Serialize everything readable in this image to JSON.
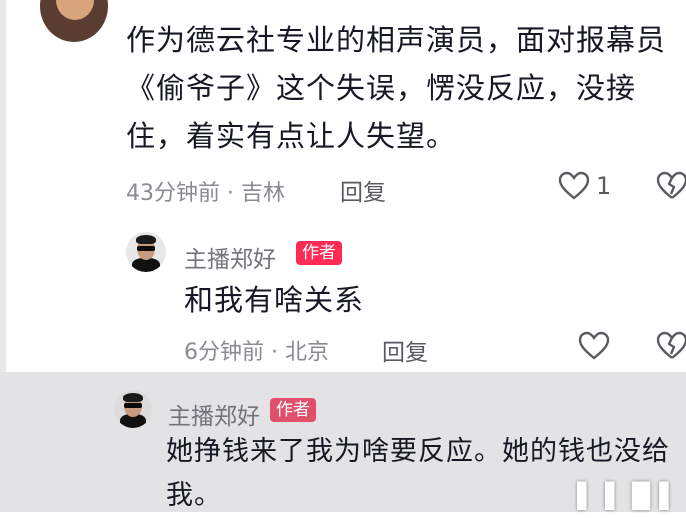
{
  "comment1": {
    "text_lines": [
      "作为德云社专业的相声演员，面对报幕员",
      "《偷爷子》这个失误，愣没反应，没接",
      "住，着实有点让人失望。"
    ],
    "meta": "43分钟前 · 吉林",
    "reply_label": "回复",
    "like_count": "1"
  },
  "reply1": {
    "author": "主播郑好",
    "badge": "作者",
    "text": "和我有啥关系",
    "meta": "6分钟前 · 北京",
    "reply_label": "回复"
  },
  "reply2": {
    "author": "主播郑好",
    "badge": "作者",
    "text_lines": [
      "她挣钱来了我为啥要反应。她的钱也没给",
      "我。"
    ]
  },
  "icons": {
    "like": "heart-outline-icon",
    "dislike": "broken-heart-icon"
  },
  "colors": {
    "badge_red": "#fe2c55",
    "meta_gray": "#8a8b91",
    "dim_background": "#e3e3e5"
  }
}
